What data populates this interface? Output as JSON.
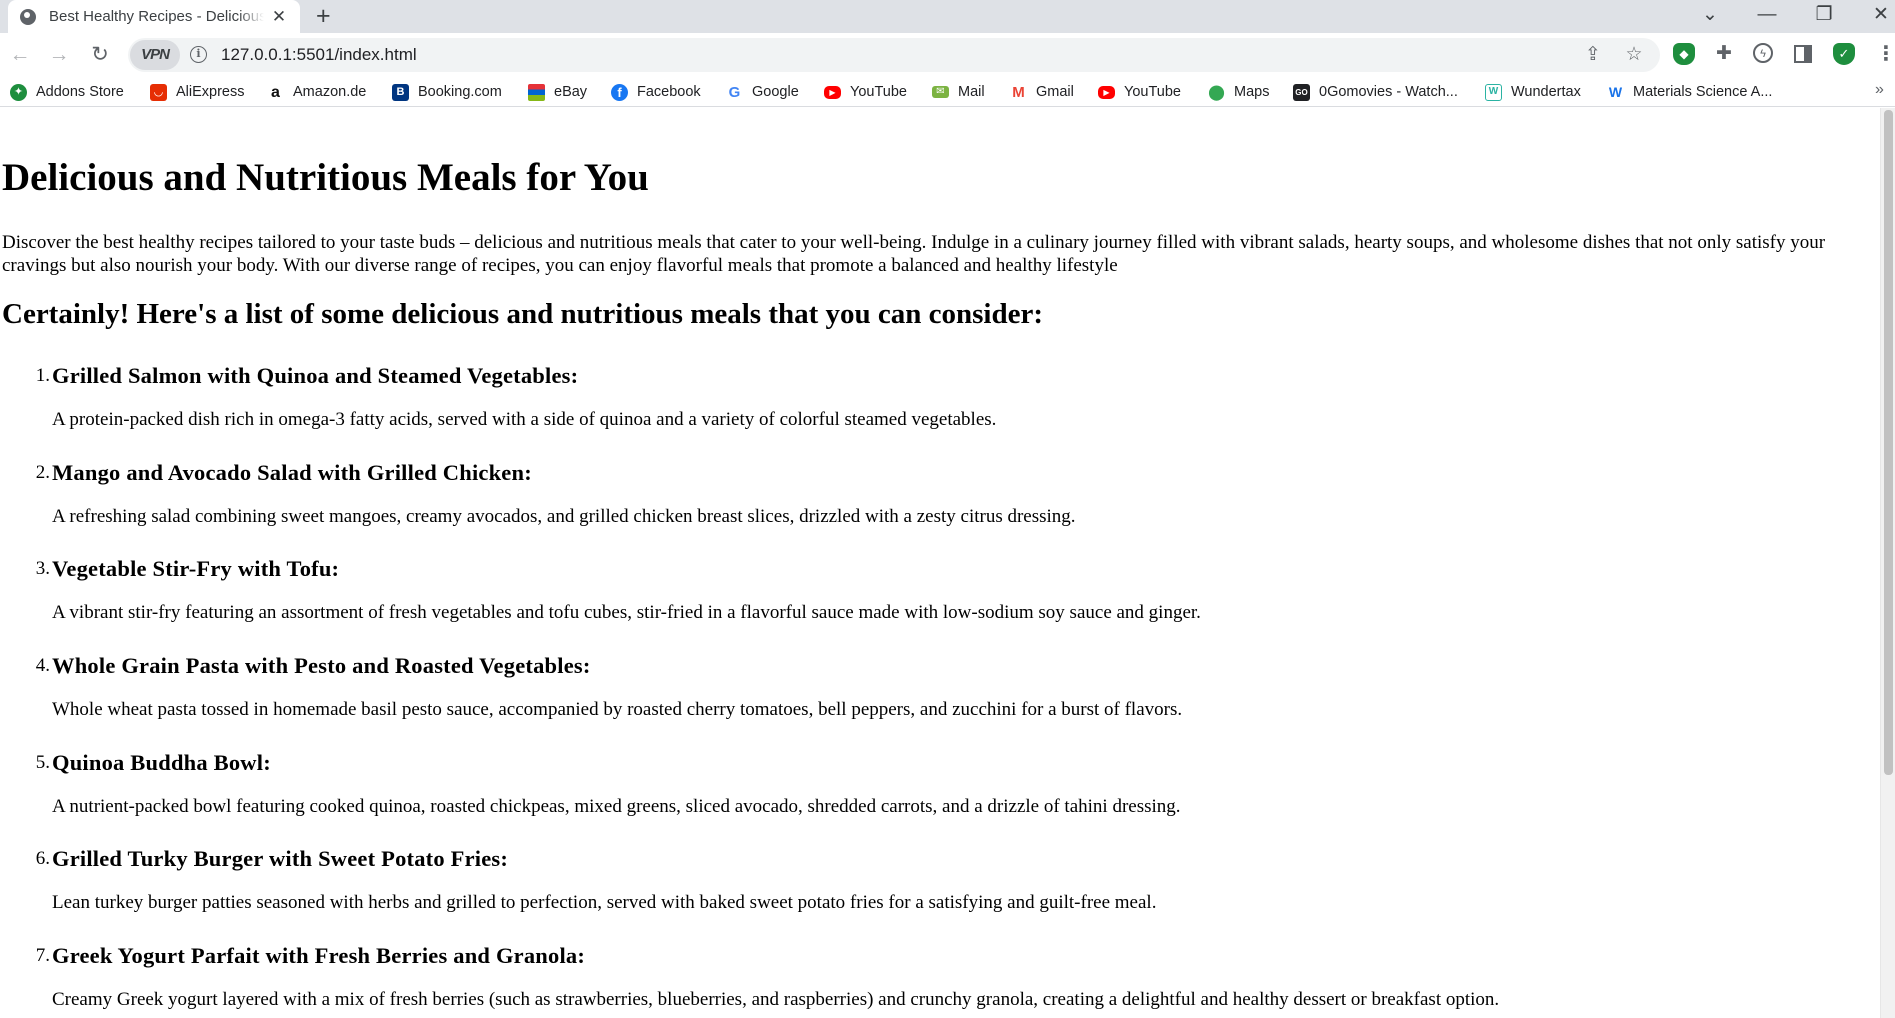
{
  "browser": {
    "tab": {
      "title": "Best Healthy Recipes - Delicious and Nutritious Meals",
      "close": "✕"
    },
    "new_tab": "+",
    "window_controls": {
      "tab_search": "⌄",
      "minimize": "—",
      "restore": "❐",
      "close": "✕"
    },
    "nav": {
      "back": "←",
      "forward": "→",
      "reload": "↻"
    },
    "vpn": "VPN",
    "info": "i",
    "url": "127.0.0.1:5501/index.html",
    "share": "⇪",
    "star": "☆",
    "menu": "⋮",
    "bookmarks_more": "»",
    "bookmarks": [
      {
        "label": "Addons Store",
        "icon": "addons-store-icon",
        "glyph": "✦",
        "color": "#1e8e3e"
      },
      {
        "label": "AliExpress",
        "icon": "aliexpress-icon",
        "glyph": "A",
        "color": "#e62e04"
      },
      {
        "label": "Amazon.de",
        "icon": "amazon-icon",
        "glyph": "a",
        "color": "#ffffff"
      },
      {
        "label": "Booking.com",
        "icon": "booking-icon",
        "glyph": "B",
        "color": "#003580"
      },
      {
        "label": "eBay",
        "icon": "ebay-icon",
        "glyph": "▤",
        "color": "#e53238"
      },
      {
        "label": "Facebook",
        "icon": "facebook-icon",
        "glyph": "f",
        "color": "#1877f2"
      },
      {
        "label": "Google",
        "icon": "google-icon",
        "glyph": "G",
        "color": "#ffffff"
      },
      {
        "label": "YouTube",
        "icon": "youtube-icon",
        "glyph": "▶",
        "color": "#ff0000"
      },
      {
        "label": "Mail",
        "icon": "mail-icon",
        "glyph": "✉",
        "color": "#7cb342"
      },
      {
        "label": "Gmail",
        "icon": "gmail-icon",
        "glyph": "M",
        "color": "#ffffff"
      },
      {
        "label": "YouTube",
        "icon": "youtube-icon",
        "glyph": "▶",
        "color": "#ff0000"
      },
      {
        "label": "Maps",
        "icon": "maps-icon",
        "glyph": "●",
        "color": "#ffffff"
      },
      {
        "label": "0Gomovies - Watch...",
        "icon": "gomovies-icon",
        "glyph": "GO",
        "color": "#202124"
      },
      {
        "label": "Wundertax",
        "icon": "wundertax-icon",
        "glyph": "W",
        "color": "#ffffff"
      },
      {
        "label": "Materials Science A...",
        "icon": "materials-science-icon",
        "glyph": "W",
        "color": "#ffffff"
      }
    ]
  },
  "page": {
    "title": "Delicious and Nutritious Meals for You",
    "intro": "Discover the best healthy recipes tailored to your taste buds – delicious and nutritious meals that cater to your well-being. Indulge in a culinary journey filled with vibrant salads, hearty soups, and wholesome dishes that not only satisfy your cravings but also nourish your body. With our diverse range of recipes, you can enjoy flavorful meals that promote a balanced and healthy lifestyle",
    "subtitle": "Certainly! Here's a list of some delicious and nutritious meals that you can consider:",
    "meals": [
      {
        "num": "1.",
        "title": "Grilled Salmon with Quinoa and Steamed Vegetables:",
        "desc": "A protein-packed dish rich in omega-3 fatty acids, served with a side of quinoa and a variety of colorful steamed vegetables."
      },
      {
        "num": "2.",
        "title": "Mango and Avocado Salad with Grilled Chicken:",
        "desc": "A refreshing salad combining sweet mangoes, creamy avocados, and grilled chicken breast slices, drizzled with a zesty citrus dressing."
      },
      {
        "num": "3.",
        "title": "Vegetable Stir-Fry with Tofu:",
        "desc": "A vibrant stir-fry featuring an assortment of fresh vegetables and tofu cubes, stir-fried in a flavorful sauce made with low-sodium soy sauce and ginger."
      },
      {
        "num": "4.",
        "title": "Whole Grain Pasta with Pesto and Roasted Vegetables:",
        "desc": "Whole wheat pasta tossed in homemade basil pesto sauce, accompanied by roasted cherry tomatoes, bell peppers, and zucchini for a burst of flavors."
      },
      {
        "num": "5.",
        "title": "Quinoa Buddha Bowl:",
        "desc": "A nutrient-packed bowl featuring cooked quinoa, roasted chickpeas, mixed greens, sliced avocado, shredded carrots, and a drizzle of tahini dressing."
      },
      {
        "num": "6.",
        "title": "Grilled Turky Burger with Sweet Potato Fries:",
        "desc": "Lean turkey burger patties seasoned with herbs and grilled to perfection, served with baked sweet potato fries for a satisfying and guilt-free meal."
      },
      {
        "num": "7.",
        "title": "Greek Yogurt Parfait with Fresh Berries and Granola:",
        "desc": "Creamy Greek yogurt layered with a mix of fresh berries (such as strawberries, blueberries, and raspberries) and crunchy granola, creating a delightful and healthy dessert or breakfast option."
      }
    ]
  }
}
